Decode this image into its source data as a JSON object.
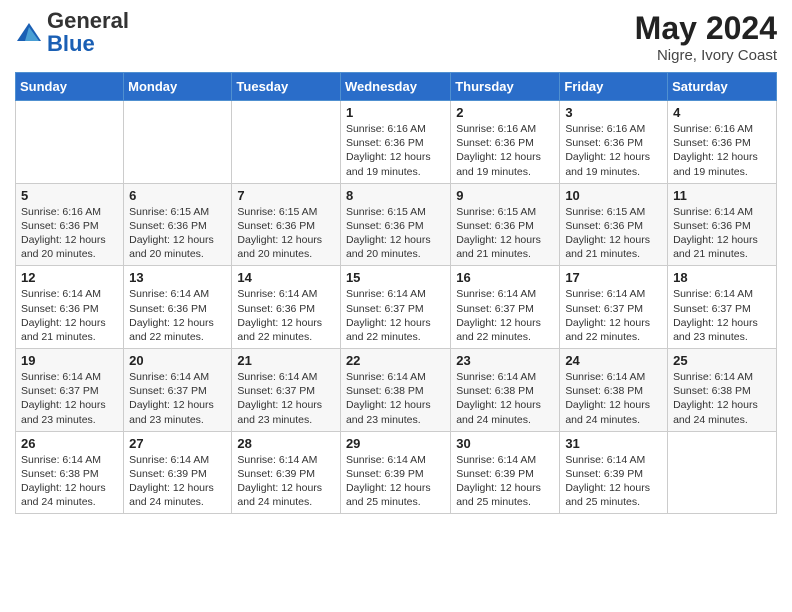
{
  "logo": {
    "general": "General",
    "blue": "Blue"
  },
  "title": "May 2024",
  "location": "Nigre, Ivory Coast",
  "days_header": [
    "Sunday",
    "Monday",
    "Tuesday",
    "Wednesday",
    "Thursday",
    "Friday",
    "Saturday"
  ],
  "weeks": [
    [
      {
        "day": "",
        "info": ""
      },
      {
        "day": "",
        "info": ""
      },
      {
        "day": "",
        "info": ""
      },
      {
        "day": "1",
        "info": "Sunrise: 6:16 AM\nSunset: 6:36 PM\nDaylight: 12 hours and 19 minutes."
      },
      {
        "day": "2",
        "info": "Sunrise: 6:16 AM\nSunset: 6:36 PM\nDaylight: 12 hours and 19 minutes."
      },
      {
        "day": "3",
        "info": "Sunrise: 6:16 AM\nSunset: 6:36 PM\nDaylight: 12 hours and 19 minutes."
      },
      {
        "day": "4",
        "info": "Sunrise: 6:16 AM\nSunset: 6:36 PM\nDaylight: 12 hours and 19 minutes."
      }
    ],
    [
      {
        "day": "5",
        "info": "Sunrise: 6:16 AM\nSunset: 6:36 PM\nDaylight: 12 hours and 20 minutes."
      },
      {
        "day": "6",
        "info": "Sunrise: 6:15 AM\nSunset: 6:36 PM\nDaylight: 12 hours and 20 minutes."
      },
      {
        "day": "7",
        "info": "Sunrise: 6:15 AM\nSunset: 6:36 PM\nDaylight: 12 hours and 20 minutes."
      },
      {
        "day": "8",
        "info": "Sunrise: 6:15 AM\nSunset: 6:36 PM\nDaylight: 12 hours and 20 minutes."
      },
      {
        "day": "9",
        "info": "Sunrise: 6:15 AM\nSunset: 6:36 PM\nDaylight: 12 hours and 21 minutes."
      },
      {
        "day": "10",
        "info": "Sunrise: 6:15 AM\nSunset: 6:36 PM\nDaylight: 12 hours and 21 minutes."
      },
      {
        "day": "11",
        "info": "Sunrise: 6:14 AM\nSunset: 6:36 PM\nDaylight: 12 hours and 21 minutes."
      }
    ],
    [
      {
        "day": "12",
        "info": "Sunrise: 6:14 AM\nSunset: 6:36 PM\nDaylight: 12 hours and 21 minutes."
      },
      {
        "day": "13",
        "info": "Sunrise: 6:14 AM\nSunset: 6:36 PM\nDaylight: 12 hours and 22 minutes."
      },
      {
        "day": "14",
        "info": "Sunrise: 6:14 AM\nSunset: 6:36 PM\nDaylight: 12 hours and 22 minutes."
      },
      {
        "day": "15",
        "info": "Sunrise: 6:14 AM\nSunset: 6:37 PM\nDaylight: 12 hours and 22 minutes."
      },
      {
        "day": "16",
        "info": "Sunrise: 6:14 AM\nSunset: 6:37 PM\nDaylight: 12 hours and 22 minutes."
      },
      {
        "day": "17",
        "info": "Sunrise: 6:14 AM\nSunset: 6:37 PM\nDaylight: 12 hours and 22 minutes."
      },
      {
        "day": "18",
        "info": "Sunrise: 6:14 AM\nSunset: 6:37 PM\nDaylight: 12 hours and 23 minutes."
      }
    ],
    [
      {
        "day": "19",
        "info": "Sunrise: 6:14 AM\nSunset: 6:37 PM\nDaylight: 12 hours and 23 minutes."
      },
      {
        "day": "20",
        "info": "Sunrise: 6:14 AM\nSunset: 6:37 PM\nDaylight: 12 hours and 23 minutes."
      },
      {
        "day": "21",
        "info": "Sunrise: 6:14 AM\nSunset: 6:37 PM\nDaylight: 12 hours and 23 minutes."
      },
      {
        "day": "22",
        "info": "Sunrise: 6:14 AM\nSunset: 6:38 PM\nDaylight: 12 hours and 23 minutes."
      },
      {
        "day": "23",
        "info": "Sunrise: 6:14 AM\nSunset: 6:38 PM\nDaylight: 12 hours and 24 minutes."
      },
      {
        "day": "24",
        "info": "Sunrise: 6:14 AM\nSunset: 6:38 PM\nDaylight: 12 hours and 24 minutes."
      },
      {
        "day": "25",
        "info": "Sunrise: 6:14 AM\nSunset: 6:38 PM\nDaylight: 12 hours and 24 minutes."
      }
    ],
    [
      {
        "day": "26",
        "info": "Sunrise: 6:14 AM\nSunset: 6:38 PM\nDaylight: 12 hours and 24 minutes."
      },
      {
        "day": "27",
        "info": "Sunrise: 6:14 AM\nSunset: 6:39 PM\nDaylight: 12 hours and 24 minutes."
      },
      {
        "day": "28",
        "info": "Sunrise: 6:14 AM\nSunset: 6:39 PM\nDaylight: 12 hours and 24 minutes."
      },
      {
        "day": "29",
        "info": "Sunrise: 6:14 AM\nSunset: 6:39 PM\nDaylight: 12 hours and 25 minutes."
      },
      {
        "day": "30",
        "info": "Sunrise: 6:14 AM\nSunset: 6:39 PM\nDaylight: 12 hours and 25 minutes."
      },
      {
        "day": "31",
        "info": "Sunrise: 6:14 AM\nSunset: 6:39 PM\nDaylight: 12 hours and 25 minutes."
      },
      {
        "day": "",
        "info": ""
      }
    ]
  ]
}
